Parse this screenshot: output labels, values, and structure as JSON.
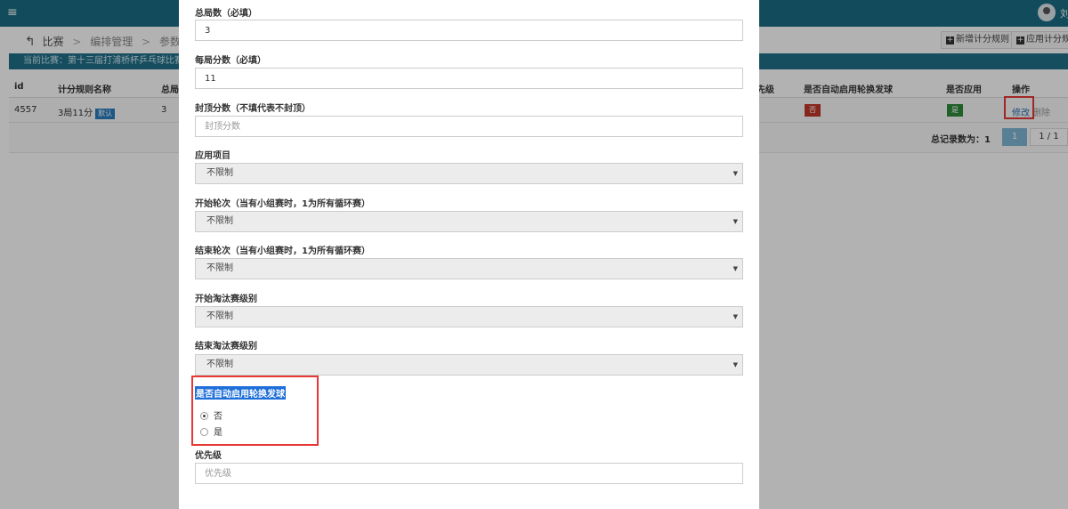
{
  "topbar": {
    "menu_icon": "hamburger-icon",
    "user_name": "刘"
  },
  "breadcrumb": {
    "back": "比赛",
    "item2": "编排管理",
    "item3": "参数设置"
  },
  "toolbar": {
    "add_rule": "新增计分规则",
    "apply_rule": "应用计分规则"
  },
  "match_bar": "当前比赛：第十三届打浦桥杯乒乓球比赛",
  "table": {
    "headers": {
      "id": "id",
      "name": "计分规则名称",
      "games": "总局",
      "priority": "先级",
      "auto_serve": "是否自动启用轮换发球",
      "applied": "是否应用",
      "ops": "操作"
    },
    "row": {
      "id": "4557",
      "name": "3局11分",
      "badge": "默认",
      "games": "3",
      "auto_serve": "否",
      "applied": "是",
      "edit": "修改",
      "delete": "删除"
    },
    "total_label": "总记录数为：1",
    "page_current": "1",
    "page_info": "1 / 1"
  },
  "form": {
    "total_games": {
      "label": "总局数（必填）",
      "value": "3"
    },
    "points_per_game": {
      "label": "每局分数（必填）",
      "value": "11"
    },
    "cap_points": {
      "label": "封顶分数（不填代表不封顶）",
      "placeholder": "封顶分数"
    },
    "apply_event": {
      "label": "应用项目",
      "value": "不限制"
    },
    "start_round": {
      "label": "开始轮次（当有小组赛时，1为所有循环赛）",
      "value": "不限制"
    },
    "end_round": {
      "label": "结束轮次（当有小组赛时，1为所有循环赛）",
      "value": "不限制"
    },
    "start_ko_level": {
      "label": "开始淘汰赛级别",
      "value": "不限制"
    },
    "end_ko_level": {
      "label": "结束淘汰赛级别",
      "value": "不限制"
    },
    "auto_serve": {
      "label": "是否自动启用轮换发球",
      "option_no": "否",
      "option_yes": "是",
      "selected": "否"
    },
    "priority": {
      "label": "优先级",
      "placeholder": "优先级"
    }
  },
  "colors": {
    "topbar": "#1b6d85",
    "match_bar": "#20708a",
    "highlight": "#e53935",
    "selection": "#1e6fd9"
  }
}
